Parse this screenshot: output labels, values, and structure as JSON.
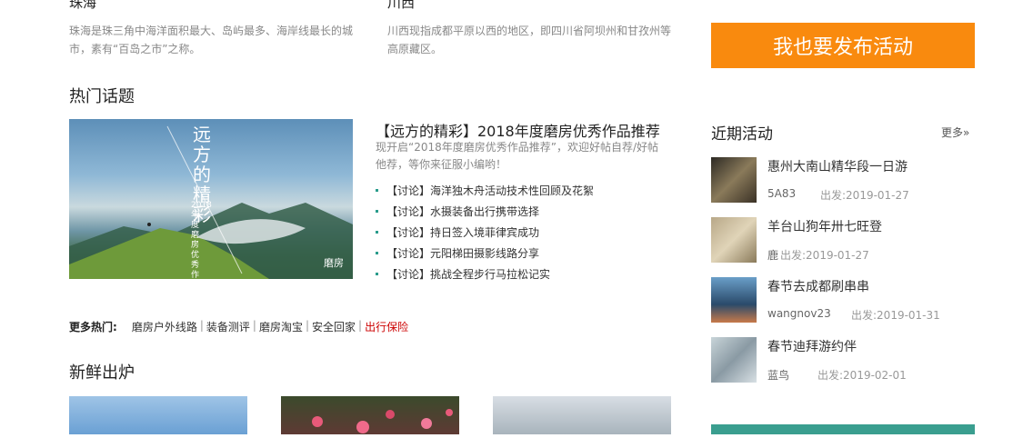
{
  "destinations": [
    {
      "title": "珠海",
      "desc": "珠海是珠三角中海洋面积最大、岛屿最多、海岸线最长的城市，素有“百岛之市”之称。"
    },
    {
      "title": "川西",
      "desc": "川西现指成都平原以西的地区，即四川省阿坝州和甘孜州等高原藏区。"
    }
  ],
  "hot_topics": {
    "heading": "热门话题",
    "feature": {
      "title": "【远方的精彩】2018年度磨房优秀作品推荐",
      "desc": "现开启“2018年度磨房优秀作品推荐”，欢迎好帖自荐/好帖他荐，等你来征服小编哟！",
      "image_text": "远方的精彩",
      "image_sub": "2018年度磨房优秀作品推荐",
      "image_logo": "磨房"
    },
    "items": [
      "【讨论】海洋独木舟活动技术性回顾及花絮",
      "【讨论】水摄装备出行携带选择",
      "【讨论】持日签入境菲律宾成功",
      "【讨论】元阳梯田摄影线路分享",
      "【讨论】挑战全程步行马拉松记实"
    ]
  },
  "more_hot": {
    "label": "更多热门:",
    "links": [
      "磨房户外线路",
      "装备测评",
      "磨房淘宝",
      "安全回家",
      "出行保险"
    ]
  },
  "fresh": {
    "heading": "新鲜出炉"
  },
  "sidebar": {
    "publish_label": "我也要发布活动",
    "recent_heading": "近期活动",
    "more_label": "更多»",
    "activities": [
      {
        "name": "惠州大南山精华段一日游",
        "user": "5A83",
        "date": "出发:2019-01-27"
      },
      {
        "name": "羊台山狗年卅七旺登",
        "user": "鹿",
        "date": "出发:2019-01-27"
      },
      {
        "name": "春节去成都刷串串",
        "user": "wangnov23",
        "date": "出发:2019-01-31"
      },
      {
        "name": "春节迪拜游约伴",
        "user": "蓝鸟",
        "date": "出发:2019-02-01"
      }
    ]
  },
  "colors": {
    "accent_orange": "#f98a0e",
    "teal": "#3a9e8f",
    "link_red": "#cc0000"
  }
}
